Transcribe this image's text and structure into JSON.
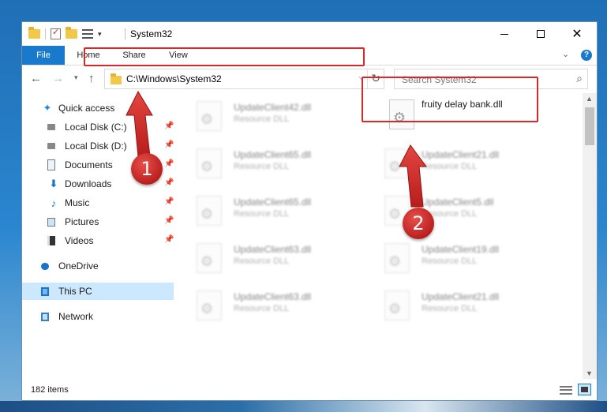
{
  "window": {
    "title": "System32",
    "minimize_icon": "minimize-icon",
    "maximize_icon": "maximize-icon",
    "close_glyph": "✕"
  },
  "ribbon": {
    "tabs": [
      {
        "label": "File"
      },
      {
        "label": "Home"
      },
      {
        "label": "Share"
      },
      {
        "label": "View"
      }
    ],
    "help_glyph": "?",
    "collapse_glyph": "⌄",
    "accent_color": "#1979ca"
  },
  "nav": {
    "back_glyph": "←",
    "forward_glyph": "→",
    "recent_glyph": "▾",
    "up_glyph": "↑",
    "address": "C:\\Windows\\System32",
    "address_dropdown_glyph": "⌵",
    "refresh_glyph": "↻",
    "search_placeholder": "Search System32",
    "search_glyph": "⌕"
  },
  "sidebar": {
    "items": [
      {
        "label": "Quick access",
        "icon": "star-icon",
        "pinned": false
      },
      {
        "label": "Local Disk (C:)",
        "icon": "drive-icon",
        "pinned": true
      },
      {
        "label": "Local Disk (D:)",
        "icon": "drive-icon",
        "pinned": true
      },
      {
        "label": "Documents",
        "icon": "documents-icon",
        "pinned": true
      },
      {
        "label": "Downloads",
        "icon": "download-icon",
        "pinned": true
      },
      {
        "label": "Music",
        "icon": "music-icon",
        "pinned": true
      },
      {
        "label": "Pictures",
        "icon": "pictures-icon",
        "pinned": true
      },
      {
        "label": "Videos",
        "icon": "videos-icon",
        "pinned": true
      },
      {
        "label": "OneDrive",
        "icon": "cloud-icon",
        "pinned": false
      },
      {
        "label": "This PC",
        "icon": "computer-icon",
        "pinned": false,
        "selected": true
      },
      {
        "label": "Network",
        "icon": "network-icon",
        "pinned": false
      }
    ],
    "pin_glyph": "📌"
  },
  "files": {
    "left_column": [
      {
        "name": "UpdateClient42.dll",
        "type": "Resource DLL"
      },
      {
        "name": "UpdateClient65.dll",
        "type": "Resource DLL"
      },
      {
        "name": "UpdateClient65.dll",
        "type": "Resource DLL"
      },
      {
        "name": "UpdateClient63.dll",
        "type": "Resource DLL"
      },
      {
        "name": "UpdateClient63.dll",
        "type": "Resource DLL"
      }
    ],
    "right_column": [
      {
        "name": "fruity delay bank.dll",
        "type": ""
      },
      {
        "name": "UpdateClient21.dll",
        "type": "Resource DLL"
      },
      {
        "name": "UpdateClient5.dll",
        "type": "Resource DLL"
      },
      {
        "name": "UpdateClient19.dll",
        "type": "Resource DLL"
      },
      {
        "name": "UpdateClient21.dll",
        "type": "Resource DLL"
      }
    ],
    "gear_glyph": "⚙"
  },
  "status": {
    "item_count": "182 items"
  },
  "annotations": {
    "badge_1": "1",
    "badge_2": "2",
    "highlight_color": "#d8282a"
  }
}
